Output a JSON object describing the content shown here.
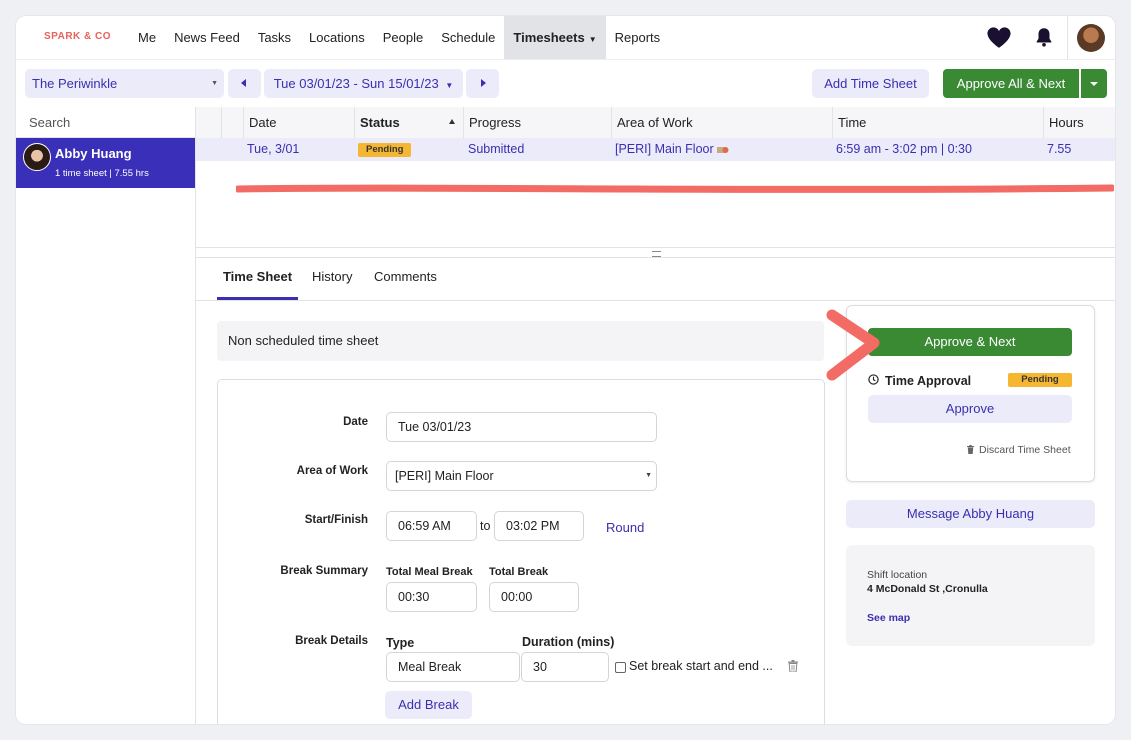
{
  "brand": {
    "logo_text": "SPARK & CO",
    "accent": "#3b2fb0",
    "green": "#3a8a34",
    "pending": "#f5b731"
  },
  "nav": {
    "items": [
      {
        "label": "Me"
      },
      {
        "label": "News Feed"
      },
      {
        "label": "Tasks"
      },
      {
        "label": "Locations"
      },
      {
        "label": "People"
      },
      {
        "label": "Schedule"
      },
      {
        "label": "Timesheets",
        "active": true
      },
      {
        "label": "Reports"
      }
    ],
    "icons": [
      "heart-icon",
      "bell-icon",
      "avatar"
    ]
  },
  "toolbar": {
    "location": "The Periwinkle",
    "date_range": "Tue 03/01/23 - Sun 15/01/23",
    "add_label": "Add Time Sheet",
    "approve_all_label": "Approve All & Next"
  },
  "sidebar": {
    "search_placeholder": "Search",
    "person": {
      "name": "Abby Huang",
      "summary": "1 time sheet | 7.55 hrs"
    }
  },
  "table": {
    "columns": [
      "Date",
      "Status",
      "Progress",
      "Area of Work",
      "Time",
      "Hours"
    ],
    "rows": [
      {
        "date": "Tue, 3/01",
        "status": "Pending",
        "progress": "Submitted",
        "area": "[PERI] Main Floor",
        "time": "6:59 am - 3:02 pm | 0:30",
        "hours": "7.55"
      }
    ]
  },
  "detail": {
    "tabs": [
      "Time Sheet",
      "History",
      "Comments"
    ],
    "notice": "Non scheduled time sheet",
    "form": {
      "date_label": "Date",
      "date_value": "Tue 03/01/23",
      "area_label": "Area of Work",
      "area_value": "[PERI] Main Floor",
      "startfinish_label": "Start/Finish",
      "start_value": "06:59 AM",
      "to_text": "to",
      "finish_value": "03:02 PM",
      "round_label": "Round",
      "break_summary_label": "Break Summary",
      "total_meal_label": "Total Meal Break",
      "total_meal_value": "00:30",
      "total_break_label": "Total Break",
      "total_break_value": "00:00",
      "break_details_label": "Break Details",
      "type_label": "Type",
      "duration_label": "Duration (mins)",
      "type_value": "Meal Break",
      "duration_value": "30",
      "set_start_end_label": "Set break start and end ...",
      "add_break_label": "Add Break"
    }
  },
  "approval": {
    "approve_next_label": "Approve & Next",
    "time_approval_label": "Time Approval",
    "status": "Pending",
    "approve_label": "Approve",
    "discard_label": "Discard Time Sheet"
  },
  "message_label": "Message Abby Huang",
  "shift": {
    "location_label": "Shift location",
    "address": "4 McDonald St ,Cronulla",
    "see_map_label": "See map"
  }
}
